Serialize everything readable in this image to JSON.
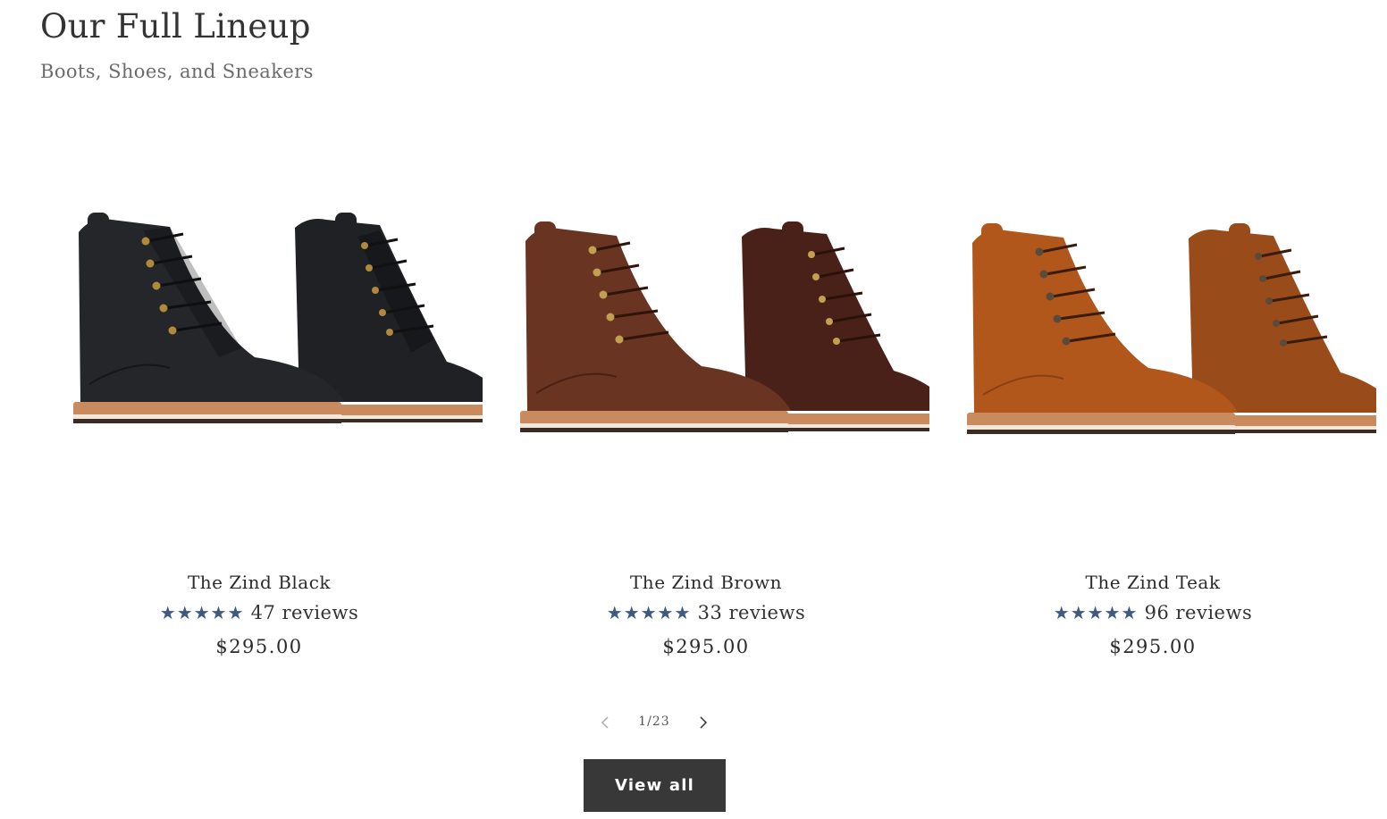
{
  "section": {
    "title": "Our Full Lineup",
    "subtitle": "Boots, Shoes, and Sneakers"
  },
  "products": [
    {
      "name": "The Zind Black",
      "stars": "★★★★★",
      "reviews": "47 reviews",
      "price": "$295.00",
      "image_icon": "black-leather-boot-image",
      "leather_color": "#1f2124"
    },
    {
      "name": "The Zind Brown",
      "stars": "★★★★★",
      "reviews": "33 reviews",
      "price": "$295.00",
      "image_icon": "brown-leather-boot-image",
      "leather_color": "#6a3422"
    },
    {
      "name": "The Zind Teak",
      "stars": "★★★★★",
      "reviews": "96 reviews",
      "price": "$295.00",
      "image_icon": "teak-leather-boot-image",
      "leather_color": "#b2571c"
    }
  ],
  "pagination": {
    "text": "1/23",
    "prev_icon": "chevron-left-icon",
    "next_icon": "chevron-right-icon"
  },
  "cta": {
    "label": "View all"
  },
  "colors": {
    "star": "#3f5a80",
    "button_bg": "#383838",
    "sole": "#c98a5e"
  }
}
